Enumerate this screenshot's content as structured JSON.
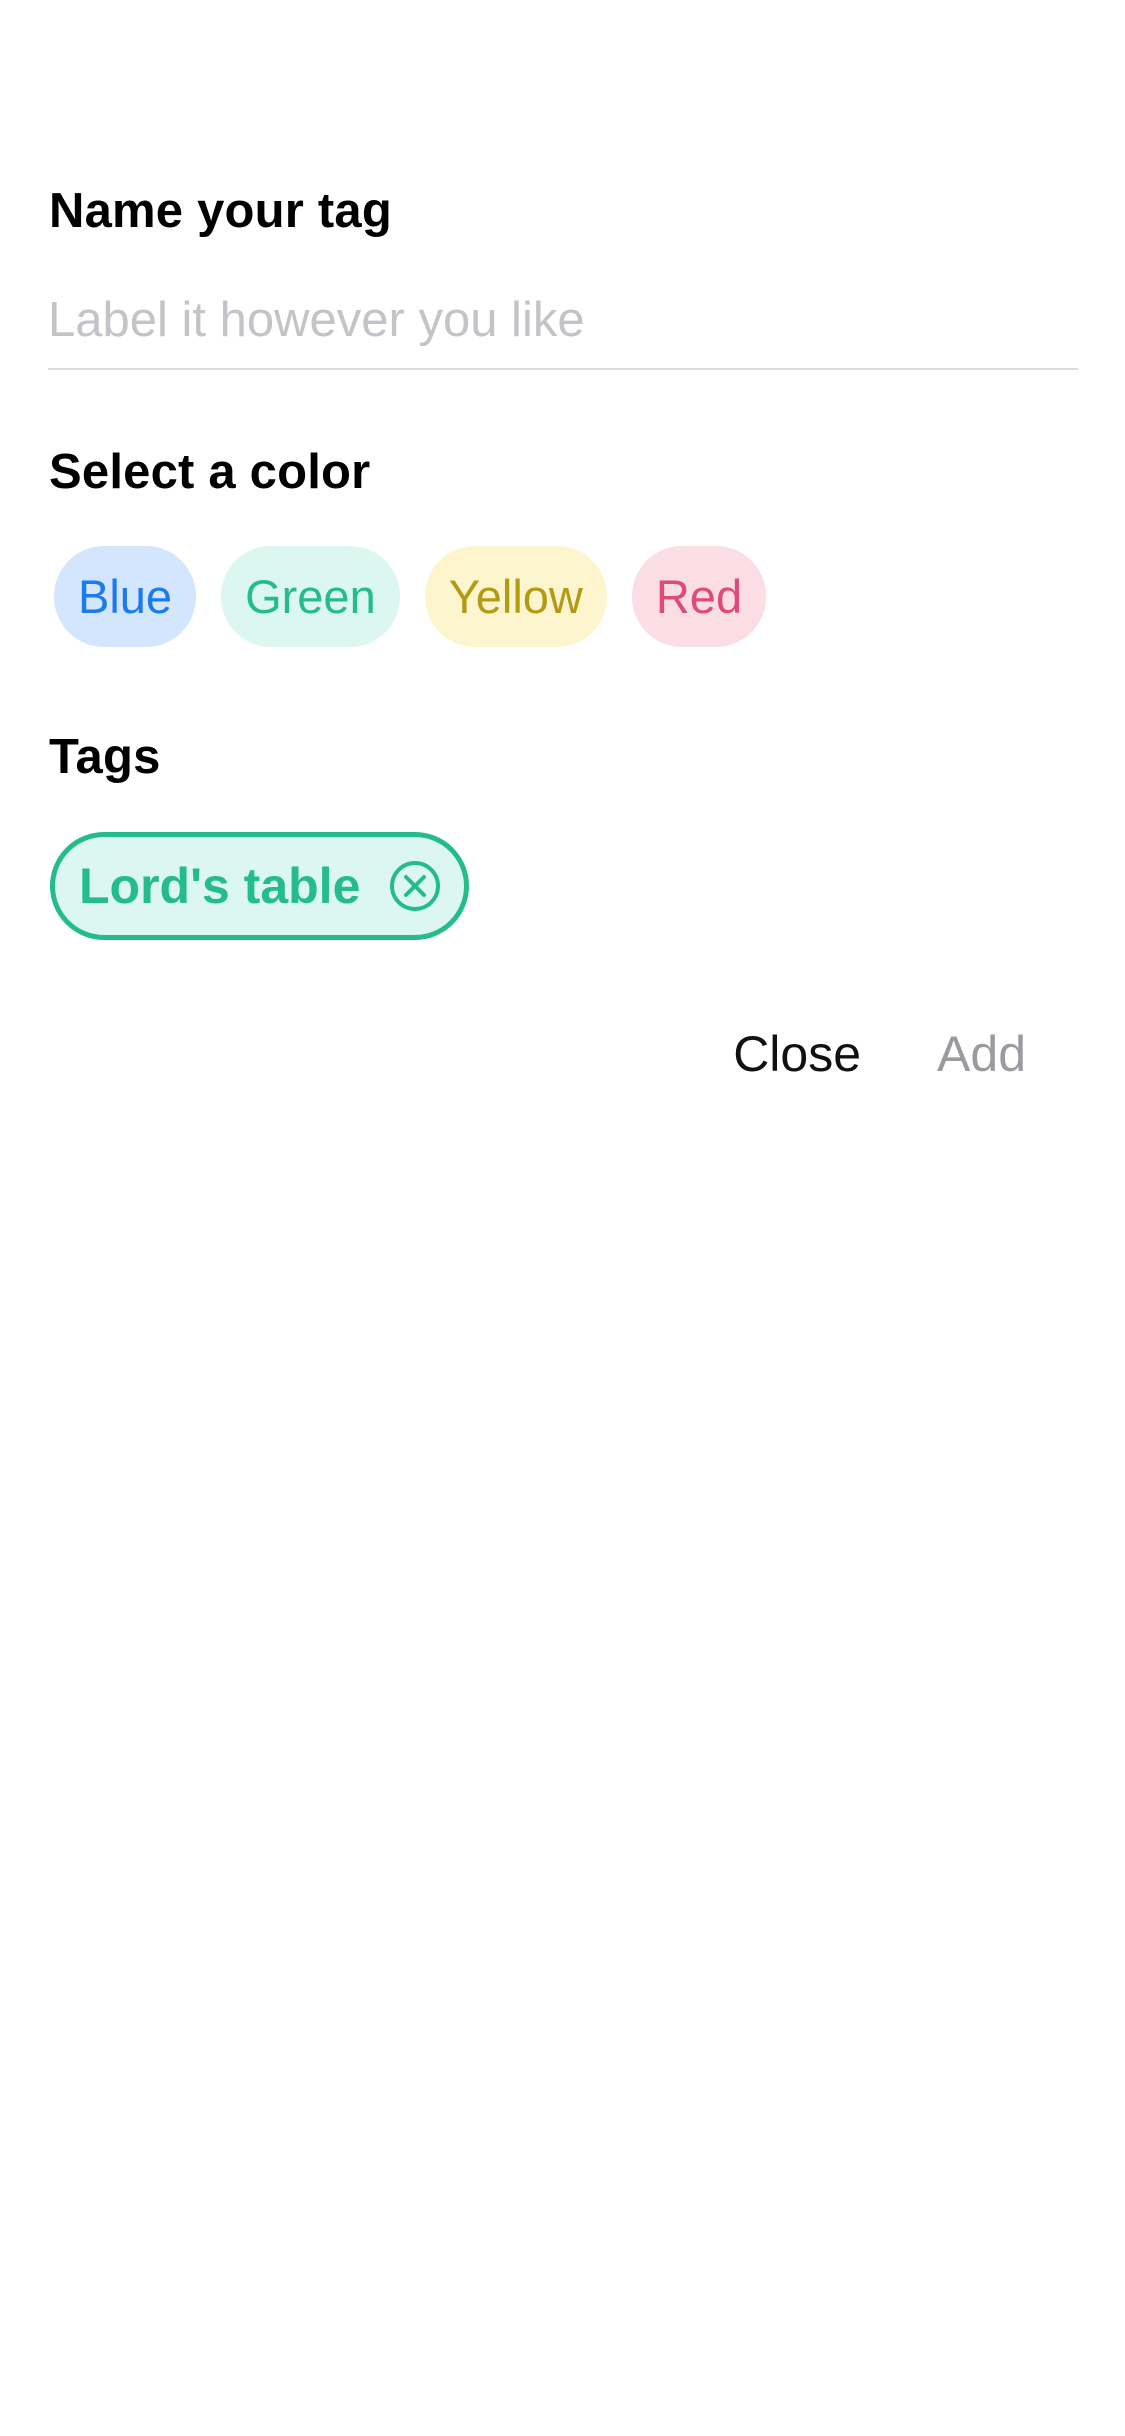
{
  "name_section": {
    "title": "Name your tag",
    "input_value": "",
    "input_placeholder": "Label it however you like"
  },
  "color_section": {
    "title": "Select a color",
    "options": [
      {
        "label": "Blue",
        "bg": "#d4e6fd",
        "fg": "#1a7af0"
      },
      {
        "label": "Green",
        "bg": "#dcf7ef",
        "fg": "#25bc8d"
      },
      {
        "label": "Yellow",
        "bg": "#fdf5cd",
        "fg": "#b49a13"
      },
      {
        "label": "Red",
        "bg": "#fbdde6",
        "fg": "#e04a7a"
      }
    ]
  },
  "tags_section": {
    "title": "Tags",
    "tags": [
      {
        "label": "Lord's table",
        "color": "#25bc8d",
        "bg": "#dcf7ef",
        "remove_icon": "close-circle-icon"
      }
    ]
  },
  "actions": {
    "close_label": "Close",
    "add_label": "Add"
  }
}
